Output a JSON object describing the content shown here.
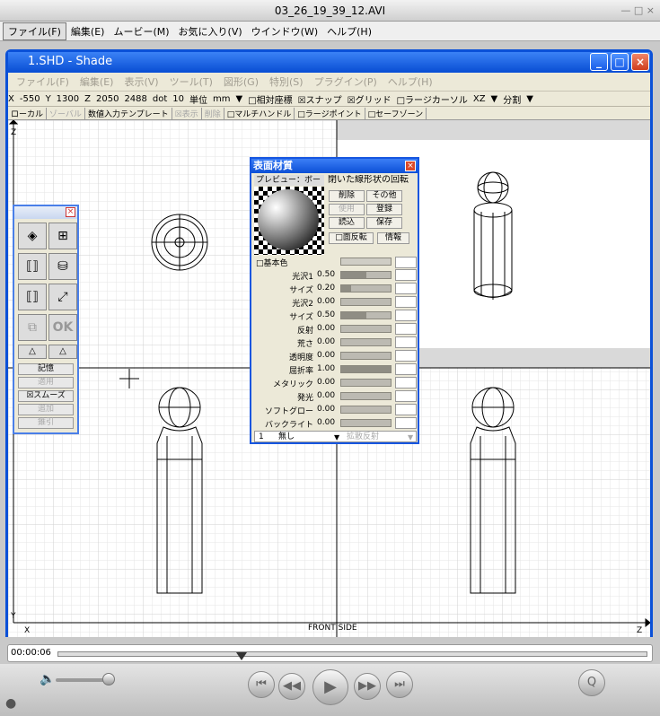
{
  "player": {
    "title": "03_26_19_39_12.AVI",
    "window_buttons": "— □ ×",
    "menu": [
      "ファイル(F)",
      "編集(E)",
      "ムービー(M)",
      "お気に入り(V)",
      "ウインドウ(W)",
      "ヘルプ(H)"
    ],
    "timecode": "00:00:06",
    "playhead_fraction": 0.31
  },
  "shade": {
    "title": "1.SHD - Shade",
    "menu": [
      "ファイル(F)",
      "編集(E)",
      "表示(V)",
      "ツール(T)",
      "図形(G)",
      "特別(S)",
      "プラグイン(P)",
      "ヘルプ(H)"
    ],
    "coordbar": [
      "X",
      "-550",
      "Y",
      "1300",
      "Z",
      "2050",
      "2488",
      "dot",
      "10",
      "単位",
      "mm",
      "▼",
      "□相対座標",
      "☒スナップ",
      "☒グリッド",
      "□ラージカーソル",
      "XZ",
      "▼",
      "分割",
      "▼"
    ],
    "options": [
      {
        "label": "ローカル",
        "disabled": false
      },
      {
        "label": "ゾーバル",
        "disabled": true
      },
      {
        "label": "数値入力テンプレート",
        "disabled": false
      },
      {
        "label": "☒表示",
        "disabled": true
      },
      {
        "label": "削除",
        "disabled": true
      },
      {
        "label": "□マルチハンドル",
        "disabled": false
      },
      {
        "label": "□ラージポイント",
        "disabled": false
      },
      {
        "label": "□セーフゾーン",
        "disabled": false
      }
    ],
    "axis_labels": {
      "z": "Z",
      "y": "Y",
      "x": "X",
      "view": "FRONT SIDE",
      "z_right": "Z"
    }
  },
  "palette": {
    "buttons": [
      "◈",
      "⊞",
      "⟦⟧",
      "⛁",
      "⟦⟧",
      "⤢",
      "⧉",
      "OK",
      "△",
      "△"
    ],
    "labels": [
      {
        "text": "記憶",
        "disabled": false
      },
      {
        "text": "適用",
        "disabled": true
      },
      {
        "text": "☒スムーズ",
        "disabled": false
      },
      {
        "text": "追加",
        "disabled": true
      },
      {
        "text": "錐引",
        "disabled": true
      }
    ]
  },
  "material": {
    "title": "表面材質",
    "preview_tab": "プレビュー：ボール",
    "info": "閉いた線形状の回転",
    "buttons": [
      {
        "label": "削除",
        "disabled": false
      },
      {
        "label": "その他",
        "disabled": false
      },
      {
        "label": "使用",
        "disabled": true
      },
      {
        "label": "登録",
        "disabled": false
      },
      {
        "label": "読込",
        "disabled": false
      },
      {
        "label": "保存",
        "disabled": false
      }
    ],
    "face_flip": "□面反転",
    "info_button": "情報",
    "base_color": "□基本色",
    "properties": [
      {
        "label": "光沢1",
        "value": "0.50"
      },
      {
        "label": "サイズ",
        "value": "0.20"
      },
      {
        "label": "光沢2",
        "value": "0.00"
      },
      {
        "label": "サイズ",
        "value": "0.50"
      },
      {
        "label": "反射",
        "value": "0.00"
      },
      {
        "label": "荒さ",
        "value": "0.00"
      },
      {
        "label": "透明度",
        "value": "0.00"
      },
      {
        "label": "屈折率",
        "value": "1.00"
      },
      {
        "label": "メタリック",
        "value": "0.00"
      },
      {
        "label": "発光",
        "value": "0.00"
      },
      {
        "label": "ソフトグロー",
        "value": "0.00"
      },
      {
        "label": "バックライト",
        "value": "0.00"
      }
    ],
    "footer": {
      "index": "1",
      "mode": "無し",
      "mapping": "拡散反射"
    }
  },
  "controls": [
    "⏮",
    "◀◀",
    "▶",
    "▶▶",
    "⏭"
  ]
}
